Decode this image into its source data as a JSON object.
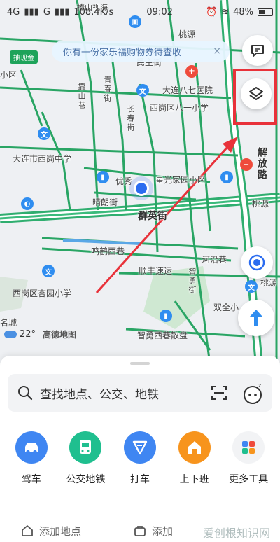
{
  "status_bar": {
    "network1": "4G",
    "network2": "G",
    "speed": "108.4K/s",
    "time": "09:02",
    "battery": "48%"
  },
  "promo": {
    "text": "你有一份家乐福购物券待查收",
    "close": "×"
  },
  "map": {
    "labels": {
      "top_left_place": "捧山视海",
      "badge": "抽现金",
      "district_top": "桃源",
      "west_small": "小区",
      "street_minzheng": "民主街",
      "hospital": "大连八七医院",
      "qingyun": "青春街",
      "xilong": "西岗区八一小学",
      "changchun": "长春街",
      "kaoshan": "靠山巷",
      "zhongxue": "大连市西岗中学",
      "youxiu": "优秀",
      "xingguang": "星光家园小区",
      "qinglang": "晴朗街",
      "jiefang": "解放路",
      "taoyuan_right": "桃源",
      "qunying": "群英街",
      "minghe": "鸣鹤西巷",
      "heyan": "河沿巷",
      "shunfeng": "顺丰速运",
      "xingang_xiaoxue": "西岗区杏园小学",
      "zhiyong": "智勇街",
      "shuangquan": "双全小",
      "mingcheng": "名城",
      "zhiyong_market": "智勇西巷散盘",
      "taoyuan_far": "桃源"
    },
    "weather": {
      "temperature": "22°",
      "brand": "高德地图"
    }
  },
  "search": {
    "placeholder": "查找地点、公交、地铁"
  },
  "shortcuts": [
    {
      "label": "驾车",
      "color": "#3f86f2"
    },
    {
      "label": "公交地铁",
      "color": "#1fbf8f"
    },
    {
      "label": "打车",
      "color": "#3f86f2"
    },
    {
      "label": "上下班",
      "color": "#f7941d"
    },
    {
      "label": "更多工具",
      "color": "#f2f3f5"
    }
  ],
  "bottom": {
    "add_place": "添加地点",
    "add_place2": "添加"
  },
  "watermark": "爱创根知识网"
}
